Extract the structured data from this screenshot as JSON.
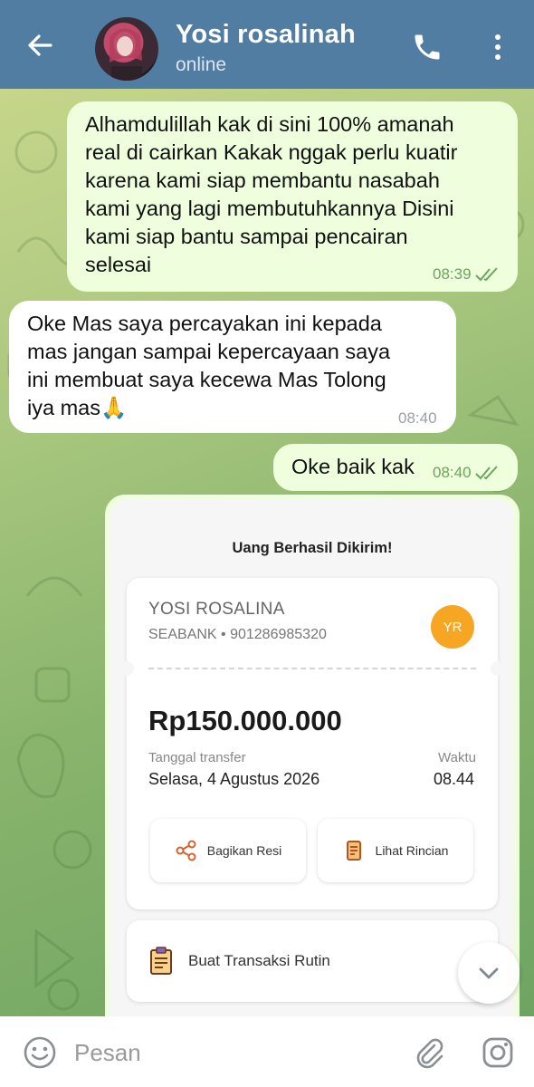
{
  "header": {
    "contact_name": "Yosi rosalinah",
    "status": "online"
  },
  "messages": [
    {
      "direction": "outgoing",
      "lines": [
        "Alhamdulillah kak di sini 100% amanah",
        "real di cairkan Kakak nggak perlu kuatir",
        "karena kami siap membantu nasabah",
        "kami yang lagi membutuhkannya Disini",
        "kami siap bantu sampai pencairan",
        "selesai"
      ],
      "time": "08:39",
      "read": true
    },
    {
      "direction": "incoming",
      "lines": [
        "Oke Mas saya percayakan ini kepada",
        "mas jangan sampai kepercayaan saya",
        "ini membuat saya kecewa Mas Tolong",
        "iya mas🙏"
      ],
      "time": "08:40"
    },
    {
      "direction": "outgoing",
      "lines": [
        "Oke baik kak"
      ],
      "time": "08:40",
      "read": true
    }
  ],
  "receipt": {
    "title": "Uang Berhasil Dikirim!",
    "recipient_name": "YOSI ROSALINA",
    "bank_account": "SEABANK • 901286985320",
    "initials": "YR",
    "amount": "Rp150.000.000",
    "date_label": "Tanggal transfer",
    "date": "Selasa, 4 Agustus 2026",
    "time_label": "Waktu",
    "time": "08.44",
    "share_label": "Bagikan Resi",
    "details_label": "Lihat Rincian",
    "routine_label": "Buat Transaksi Rutin"
  },
  "input": {
    "placeholder": "Pesan"
  },
  "colors": {
    "header": "#527da3",
    "outgoing_bubble": "#effedd",
    "incoming_bubble": "#ffffff",
    "check_marks": "#6aa65b",
    "badge": "#f6a623"
  },
  "icons": {
    "back": "arrow-left-icon",
    "call": "phone-icon",
    "menu": "more-vertical-icon",
    "read": "double-check-icon",
    "share": "share-icon",
    "details": "receipt-icon",
    "routine": "clipboard-icon",
    "scroll": "chevron-down-icon",
    "emoji": "smiley-icon",
    "attach": "paperclip-icon",
    "camera": "instagram-camera-icon"
  }
}
